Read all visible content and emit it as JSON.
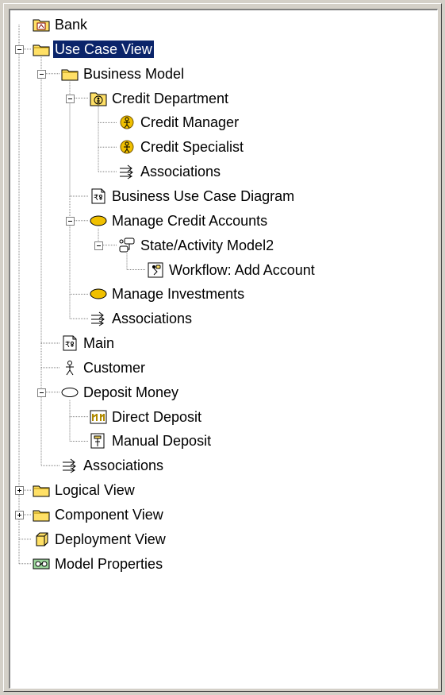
{
  "tree": {
    "nodes": [
      {
        "label": "Bank",
        "icon": "model-root-icon",
        "level": 0,
        "expander": "none",
        "selected": false
      },
      {
        "label": "Use Case View",
        "icon": "folder-icon",
        "level": 0,
        "expander": "minus",
        "selected": true
      },
      {
        "label": "Business Model",
        "icon": "folder-icon",
        "level": 1,
        "expander": "minus",
        "selected": false
      },
      {
        "label": "Credit Department",
        "icon": "organization-unit-icon",
        "level": 2,
        "expander": "minus",
        "selected": false
      },
      {
        "label": "Credit Manager",
        "icon": "business-worker-icon",
        "level": 3,
        "expander": "none",
        "selected": false
      },
      {
        "label": "Credit Specialist",
        "icon": "business-worker-icon",
        "level": 3,
        "expander": "none",
        "selected": false
      },
      {
        "label": "Associations",
        "icon": "associations-icon",
        "level": 3,
        "expander": "none",
        "selected": false
      },
      {
        "label": "Business Use Case Diagram",
        "icon": "use-case-diagram-icon",
        "level": 2,
        "expander": "none",
        "selected": false
      },
      {
        "label": "Manage Credit Accounts",
        "icon": "business-use-case-icon",
        "level": 2,
        "expander": "minus",
        "selected": false
      },
      {
        "label": "State/Activity Model2",
        "icon": "state-activity-model-icon",
        "level": 3,
        "expander": "minus",
        "selected": false
      },
      {
        "label": "Workflow: Add Account",
        "icon": "activity-diagram-icon",
        "level": 4,
        "expander": "none",
        "selected": false
      },
      {
        "label": "Manage Investments",
        "icon": "business-use-case-icon",
        "level": 2,
        "expander": "none",
        "selected": false
      },
      {
        "label": "Associations",
        "icon": "associations-icon",
        "level": 2,
        "expander": "none",
        "selected": false
      },
      {
        "label": "Main",
        "icon": "use-case-diagram-icon",
        "level": 1,
        "expander": "none",
        "selected": false
      },
      {
        "label": "Customer",
        "icon": "actor-icon",
        "level": 1,
        "expander": "none",
        "selected": false
      },
      {
        "label": "Deposit Money",
        "icon": "use-case-icon",
        "level": 1,
        "expander": "minus",
        "selected": false
      },
      {
        "label": "Direct Deposit",
        "icon": "collaboration-diagram-icon",
        "level": 2,
        "expander": "none",
        "selected": false
      },
      {
        "label": "Manual Deposit",
        "icon": "sequence-diagram-icon",
        "level": 2,
        "expander": "none",
        "selected": false
      },
      {
        "label": "Associations",
        "icon": "associations-icon",
        "level": 1,
        "expander": "none",
        "selected": false
      },
      {
        "label": "Logical View",
        "icon": "folder-icon",
        "level": 0,
        "expander": "plus",
        "selected": false
      },
      {
        "label": "Component View",
        "icon": "folder-icon",
        "level": 0,
        "expander": "plus",
        "selected": false
      },
      {
        "label": "Deployment View",
        "icon": "deployment-view-icon",
        "level": 0,
        "expander": "none",
        "selected": false
      },
      {
        "label": "Model Properties",
        "icon": "model-properties-icon",
        "level": 0,
        "expander": "none",
        "selected": false
      }
    ]
  },
  "colors": {
    "selection_bg": "#0a246a",
    "folder_yellow": "#ffe066",
    "icon_outline": "#000000",
    "tree_line": "#808080"
  }
}
